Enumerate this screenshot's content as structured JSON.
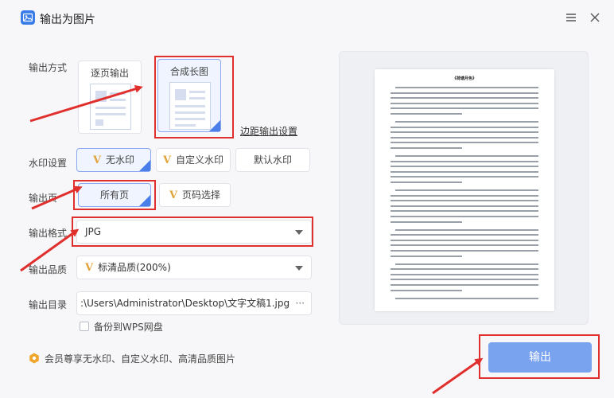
{
  "title": "输出为图片",
  "output_mode": {
    "label": "输出方式",
    "options": [
      {
        "label": "逐页输出",
        "selected": false
      },
      {
        "label": "合成长图",
        "selected": true
      }
    ],
    "margin_link": "边距输出设置"
  },
  "watermark": {
    "label": "水印设置",
    "options": [
      {
        "label": "无水印",
        "vip": true,
        "selected": true
      },
      {
        "label": "自定义水印",
        "vip": true,
        "selected": false
      },
      {
        "label": "默认水印",
        "vip": false,
        "selected": false
      }
    ]
  },
  "pages": {
    "label": "输出页",
    "options": [
      {
        "label": "所有页",
        "vip": false,
        "selected": true
      },
      {
        "label": "页码选择",
        "vip": true,
        "selected": false
      }
    ]
  },
  "format": {
    "label": "输出格式",
    "value": "JPG"
  },
  "quality": {
    "label": "输出品质",
    "value": "标清品质(200%)"
  },
  "directory": {
    "label": "输出目录",
    "value": ":\\Users\\Administrator\\Desktop\\文字文稿1.jpg",
    "more": "···"
  },
  "backup": {
    "label": "备份到WPS网盘",
    "checked": false
  },
  "member_note": "会员尊享无水印、自定义水印、高清品质图片",
  "vip_glyph": "V",
  "preview": {
    "doc_title": "《荷塘月色》"
  },
  "export_button": "输出",
  "colors": {
    "accent": "#7aa3ef",
    "highlight": "#e0302e",
    "vip": "#e2a33a"
  }
}
